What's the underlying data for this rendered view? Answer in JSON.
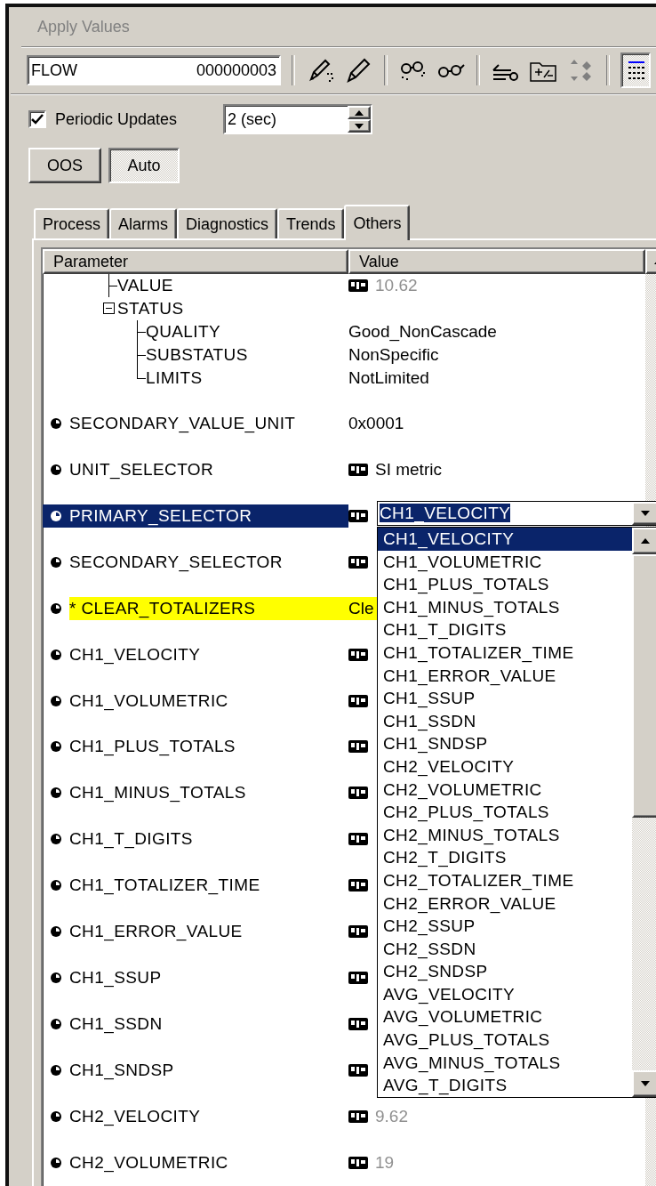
{
  "header": {
    "title": "Apply Values"
  },
  "toolbar": {
    "tag": "FLOW",
    "block_id": "000000003",
    "list_view_pressed": true
  },
  "periodic_updates": {
    "label": "Periodic Updates",
    "checked": true,
    "interval": "2 (sec)"
  },
  "mode_buttons": [
    {
      "label": "OOS",
      "pressed": false
    },
    {
      "label": "Auto",
      "pressed": true
    }
  ],
  "tabs": [
    {
      "label": "Process",
      "selected": false
    },
    {
      "label": "Alarms",
      "selected": false
    },
    {
      "label": "Diagnostics",
      "selected": false
    },
    {
      "label": "Trends",
      "selected": false
    },
    {
      "label": "Others",
      "selected": true
    }
  ],
  "grid": {
    "columns": [
      "Parameter",
      "Value"
    ],
    "tree": [
      {
        "label": "VALUE",
        "value": "10.62",
        "icon": true,
        "greyed": true
      },
      {
        "label": "STATUS",
        "expanded": true,
        "children": [
          {
            "label": "QUALITY",
            "value": "Good_NonCascade",
            "icon": false,
            "greyed": false
          },
          {
            "label": "SUBSTATUS",
            "value": "NonSpecific",
            "icon": false,
            "greyed": false
          },
          {
            "label": "LIMITS",
            "value": "NotLimited",
            "icon": false,
            "greyed": false
          }
        ]
      }
    ],
    "rows": [
      {
        "name": "SECONDARY_VALUE_UNIT",
        "value": "0x0001",
        "icon": false,
        "greyed": false,
        "selected": false,
        "highlighted": false
      },
      {
        "name": "UNIT_SELECTOR",
        "value": "SI metric",
        "icon": true,
        "greyed": false,
        "selected": false,
        "highlighted": false
      },
      {
        "name": "PRIMARY_SELECTOR",
        "icon": true,
        "selected": true,
        "highlighted": false
      },
      {
        "name": "SECONDARY_SELECTOR",
        "icon": true,
        "selected": false,
        "highlighted": false
      },
      {
        "name": "* CLEAR_TOTALIZERS",
        "value": "Cle",
        "icon": false,
        "greyed": false,
        "selected": false,
        "highlighted": true
      },
      {
        "name": "CH1_VELOCITY",
        "icon": true,
        "selected": false,
        "highlighted": false
      },
      {
        "name": "CH1_VOLUMETRIC",
        "icon": true,
        "selected": false,
        "highlighted": false
      },
      {
        "name": "CH1_PLUS_TOTALS",
        "icon": true,
        "selected": false,
        "highlighted": false
      },
      {
        "name": "CH1_MINUS_TOTALS",
        "icon": true,
        "selected": false,
        "highlighted": false
      },
      {
        "name": "CH1_T_DIGITS",
        "icon": true,
        "selected": false,
        "highlighted": false
      },
      {
        "name": "CH1_TOTALIZER_TIME",
        "icon": true,
        "selected": false,
        "highlighted": false
      },
      {
        "name": "CH1_ERROR_VALUE",
        "icon": true,
        "selected": false,
        "highlighted": false
      },
      {
        "name": "CH1_SSUP",
        "icon": true,
        "selected": false,
        "highlighted": false
      },
      {
        "name": "CH1_SSDN",
        "icon": true,
        "selected": false,
        "highlighted": false
      },
      {
        "name": "CH1_SNDSP",
        "icon": true,
        "selected": false,
        "highlighted": false
      },
      {
        "name": "CH2_VELOCITY",
        "value": "9.62",
        "icon": true,
        "greyed": true,
        "selected": false,
        "highlighted": false
      },
      {
        "name": "CH2_VOLUMETRIC",
        "value": "19",
        "icon": true,
        "greyed": true,
        "selected": false,
        "highlighted": false
      }
    ]
  },
  "combo": {
    "value": "CH1_VELOCITY",
    "options": [
      {
        "label": "CH1_VELOCITY",
        "selected": true
      },
      {
        "label": "CH1_VOLUMETRIC",
        "selected": false
      },
      {
        "label": "CH1_PLUS_TOTALS",
        "selected": false
      },
      {
        "label": "CH1_MINUS_TOTALS",
        "selected": false
      },
      {
        "label": "CH1_T_DIGITS",
        "selected": false
      },
      {
        "label": "CH1_TOTALIZER_TIME",
        "selected": false
      },
      {
        "label": "CH1_ERROR_VALUE",
        "selected": false
      },
      {
        "label": "CH1_SSUP",
        "selected": false
      },
      {
        "label": "CH1_SSDN",
        "selected": false
      },
      {
        "label": "CH1_SNDSP",
        "selected": false
      },
      {
        "label": "CH2_VELOCITY",
        "selected": false
      },
      {
        "label": "CH2_VOLUMETRIC",
        "selected": false
      },
      {
        "label": "CH2_PLUS_TOTALS",
        "selected": false
      },
      {
        "label": "CH2_MINUS_TOTALS",
        "selected": false
      },
      {
        "label": "CH2_T_DIGITS",
        "selected": false
      },
      {
        "label": "CH2_TOTALIZER_TIME",
        "selected": false
      },
      {
        "label": "CH2_ERROR_VALUE",
        "selected": false
      },
      {
        "label": "CH2_SSUP",
        "selected": false
      },
      {
        "label": "CH2_SSDN",
        "selected": false
      },
      {
        "label": "CH2_SNDSP",
        "selected": false
      },
      {
        "label": "AVG_VELOCITY",
        "selected": false
      },
      {
        "label": "AVG_VOLUMETRIC",
        "selected": false
      },
      {
        "label": "AVG_PLUS_TOTALS",
        "selected": false
      },
      {
        "label": "AVG_MINUS_TOTALS",
        "selected": false
      },
      {
        "label": "AVG_T_DIGITS",
        "selected": false
      }
    ]
  }
}
